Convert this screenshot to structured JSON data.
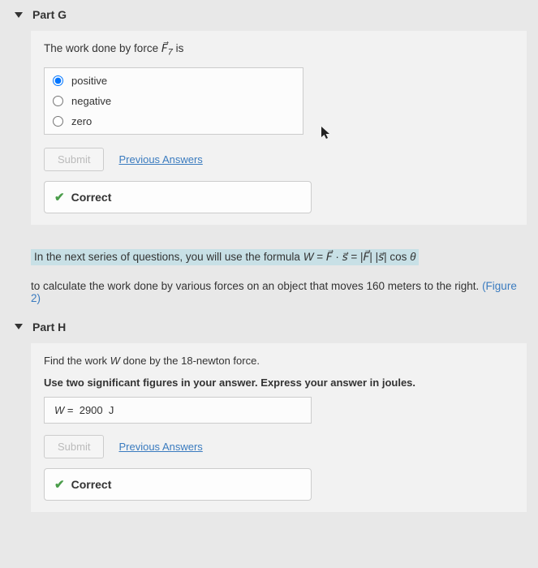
{
  "partG": {
    "label": "Part G",
    "prompt_pre": "The work done by force ",
    "prompt_var": "F",
    "prompt_sub": "7",
    "prompt_post": " is",
    "options": {
      "a": "positive",
      "b": "negative",
      "c": "zero"
    },
    "submit": "Submit",
    "prev": "Previous Answers",
    "correct": "Correct"
  },
  "info": {
    "line1_pre": "In the next series of questions, you will use the formula ",
    "formula": "W = F · s = |F| |s| cos θ",
    "line2_pre": "to calculate the work done by various forces on an object that moves 160 meters to the right. ",
    "fig": "(Figure 2)"
  },
  "partH": {
    "label": "Part H",
    "prompt": "Find the work W done by the 18-newton force.",
    "instruction": "Use two significant figures in your answer. Express your answer in joules.",
    "answer_label": "W =",
    "answer_value": "2900",
    "answer_unit": "J",
    "submit": "Submit",
    "prev": "Previous Answers",
    "correct": "Correct"
  }
}
